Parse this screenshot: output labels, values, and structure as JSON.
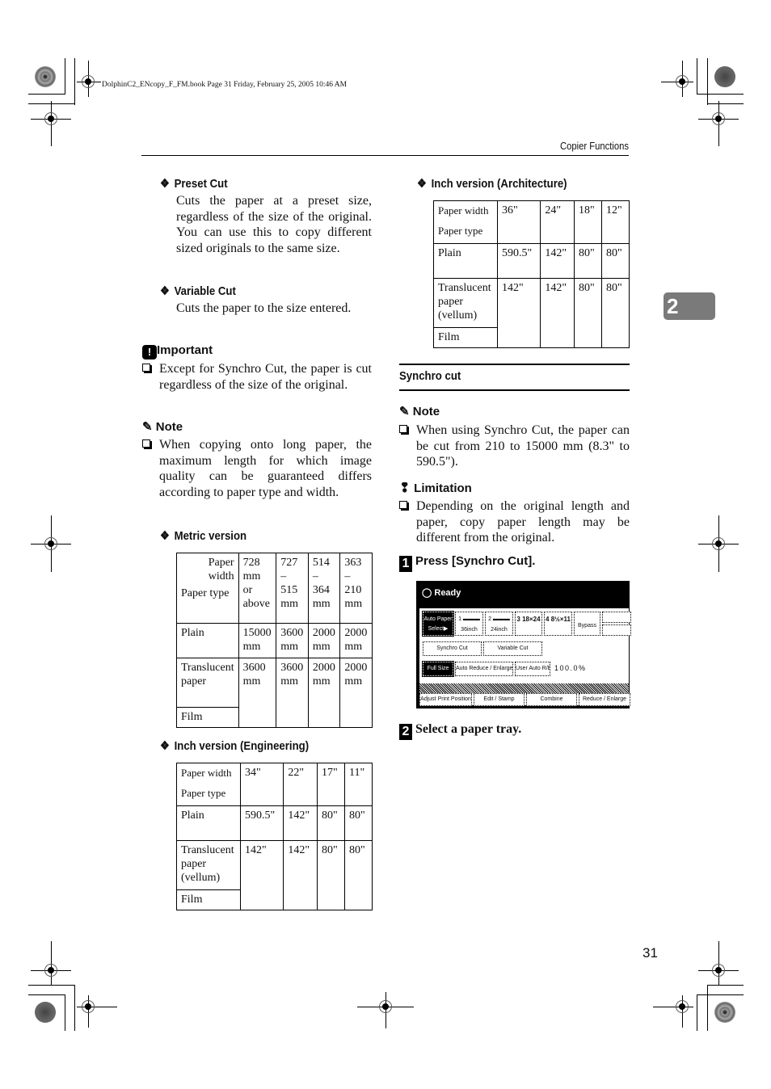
{
  "header": {
    "file_info": "DolphinC2_ENcopy_F_FM.book  Page 31  Friday, February 25, 2005  10:46 AM",
    "section": "Copier Functions",
    "chapter_tab": "2",
    "page_number": "31"
  },
  "left": {
    "preset_cut": {
      "title": "Preset Cut",
      "text": "Cuts the paper at a preset size, regardless of the size of the original. You can use this to copy different sized originals to the same size."
    },
    "variable_cut": {
      "title": "Variable Cut",
      "text": "Cuts the paper to the size entered."
    },
    "important": {
      "title": "Important",
      "text": "Except for Synchro Cut, the paper is cut regardless of the size of the original."
    },
    "note": {
      "title": "Note",
      "text": "When copying onto long paper, the maximum length for which image quality can be guaranteed differs according to paper type and width."
    },
    "metric": {
      "title": "Metric version",
      "header_width": "Paper width",
      "header_type": "Paper type",
      "columns": [
        "728 mm or above",
        "727 – 515 mm",
        "514 – 364 mm",
        "363 – 210 mm"
      ],
      "rows": [
        {
          "type": "Plain",
          "values": [
            "15000 mm",
            "3600 mm",
            "2000 mm",
            "2000 mm"
          ]
        },
        {
          "type": "Translucent paper",
          "values": [
            "3600 mm",
            "3600 mm",
            "2000 mm",
            "2000 mm"
          ]
        },
        {
          "type": "Film"
        }
      ]
    },
    "engineering": {
      "title": "Inch version (Engineering)",
      "header_width": "Paper width",
      "header_type": "Paper type",
      "columns": [
        "34\"",
        "22\"",
        "17\"",
        "11\""
      ],
      "rows": [
        {
          "type": "Plain",
          "values": [
            "590.5\"",
            "142\"",
            "80\"",
            "80\""
          ]
        },
        {
          "type": "Translucent paper (vellum)",
          "values": [
            "142\"",
            "142\"",
            "80\"",
            "80\""
          ]
        },
        {
          "type": "Film"
        }
      ]
    }
  },
  "right": {
    "architecture": {
      "title": "Inch version (Architecture)",
      "header_width": "Paper width",
      "header_type": "Paper type",
      "columns": [
        "36\"",
        "24\"",
        "18\"",
        "12\""
      ],
      "rows": [
        {
          "type": "Plain",
          "values": [
            "590.5\"",
            "142\"",
            "80\"",
            "80\""
          ]
        },
        {
          "type": "Translucent paper (vellum)",
          "values": [
            "142\"",
            "142\"",
            "80\"",
            "80\""
          ]
        },
        {
          "type": "Film"
        }
      ]
    },
    "section_title": "Synchro cut",
    "note": {
      "title": "Note",
      "text": "When using Synchro Cut, the paper can be cut from 210 to 15000 mm (8.3\" to 590.5\")."
    },
    "limitation": {
      "title": "Limitation",
      "text": "Depending on the original length and paper, copy paper length may be different from the original."
    },
    "steps": [
      {
        "num": "1",
        "text": "Press [Synchro Cut]."
      },
      {
        "num": "2",
        "text": "Select a paper tray."
      }
    ]
  },
  "panel": {
    "status": "Ready",
    "trays": [
      {
        "label": "Auto Paper Select▶",
        "selected": true
      },
      {
        "label": "1 ▬▬▬ 36inch"
      },
      {
        "label": "2 ▬▬▬ 24inch"
      },
      {
        "label": "3 18×24"
      },
      {
        "label": "4 8½×11"
      },
      {
        "label": "Bypass"
      }
    ],
    "cut_buttons": [
      "Synchro Cut",
      "Variable Cut"
    ],
    "ratio_buttons": [
      {
        "label": "Full Size",
        "selected": true
      },
      {
        "label": "Auto Reduce / Enlarge"
      },
      {
        "label": "User Auto R/E"
      }
    ],
    "ratio_value": "100.0%",
    "bottom_tabs": [
      "Adjust Print Position",
      "Edit / Stamp",
      "Combine",
      "Reduce / Enlarge"
    ]
  }
}
